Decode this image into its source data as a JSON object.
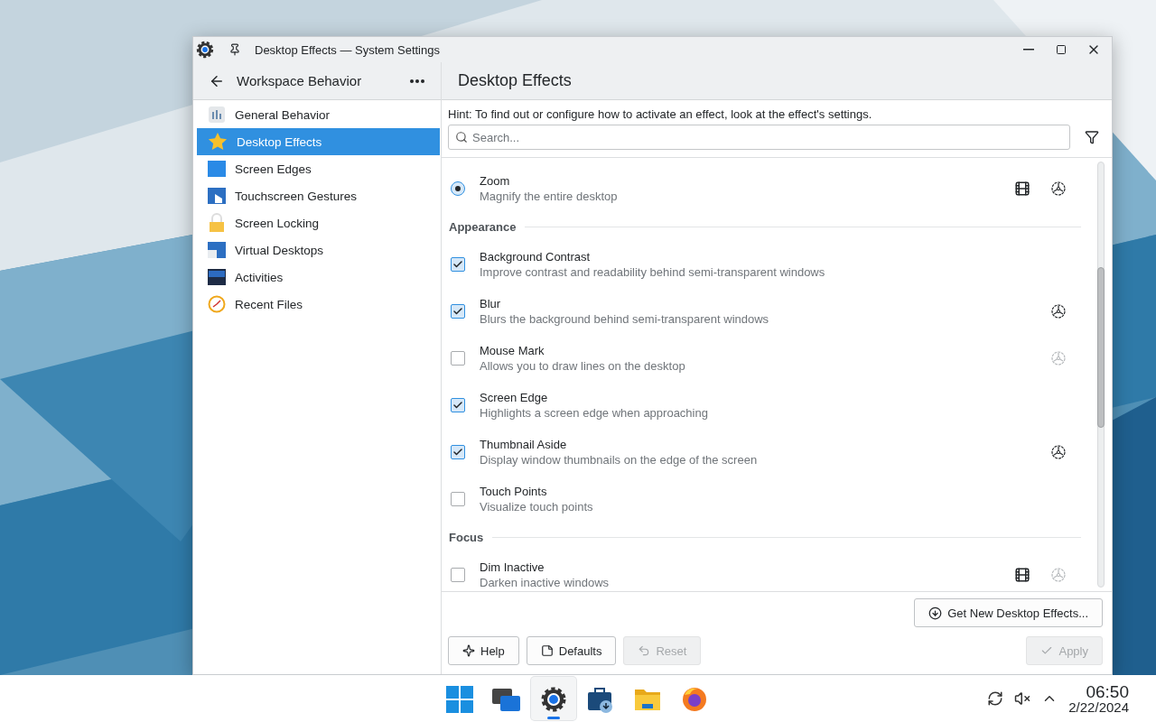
{
  "window": {
    "title": "Desktop Effects — System Settings"
  },
  "sidebar": {
    "title": "Workspace Behavior",
    "items": [
      {
        "label": "General Behavior",
        "selected": false
      },
      {
        "label": "Desktop Effects",
        "selected": true
      },
      {
        "label": "Screen Edges",
        "selected": false
      },
      {
        "label": "Touchscreen Gestures",
        "selected": false
      },
      {
        "label": "Screen Locking",
        "selected": false
      },
      {
        "label": "Virtual Desktops",
        "selected": false
      },
      {
        "label": "Activities",
        "selected": false
      },
      {
        "label": "Recent Files",
        "selected": false
      }
    ]
  },
  "page": {
    "title": "Desktop Effects",
    "hint": "Hint: To find out or configure how to activate an effect, look at the effect's settings.",
    "search": {
      "placeholder": "Search..."
    }
  },
  "effects": [
    {
      "kind": "radio",
      "name": "Zoom",
      "description": "Magnify the entire desktop",
      "selected": true,
      "video": true,
      "settings_enabled": true
    },
    {
      "kind": "section",
      "title": "Appearance"
    },
    {
      "kind": "checkbox",
      "name": "Background Contrast",
      "description": "Improve contrast and readability behind semi-transparent windows",
      "checked": true
    },
    {
      "kind": "checkbox",
      "name": "Blur",
      "description": "Blurs the background behind semi-transparent windows",
      "checked": true,
      "settings_enabled": true
    },
    {
      "kind": "checkbox",
      "name": "Mouse Mark",
      "description": "Allows you to draw lines on the desktop",
      "checked": false,
      "settings_enabled": false
    },
    {
      "kind": "checkbox",
      "name": "Screen Edge",
      "description": "Highlights a screen edge when approaching",
      "checked": true
    },
    {
      "kind": "checkbox",
      "name": "Thumbnail Aside",
      "description": "Display window thumbnails on the edge of the screen",
      "checked": true,
      "settings_enabled": true
    },
    {
      "kind": "checkbox",
      "name": "Touch Points",
      "description": "Visualize touch points",
      "checked": false
    },
    {
      "kind": "section",
      "title": "Focus"
    },
    {
      "kind": "checkbox",
      "name": "Dim Inactive",
      "description": "Darken inactive windows",
      "checked": false,
      "video": true,
      "settings_enabled": false
    }
  ],
  "get_new_button": "Get New Desktop Effects...",
  "buttons": [
    {
      "kind": "help",
      "label": "Help",
      "disabled": false
    },
    {
      "kind": "defaults",
      "label": "Defaults",
      "disabled": false
    },
    {
      "kind": "reset",
      "label": "Reset",
      "disabled": true
    },
    {
      "kind": "apply",
      "label": "Apply",
      "disabled": true
    }
  ],
  "taskbar": {
    "apps": [
      {
        "kind": "start",
        "active": false
      },
      {
        "kind": "windows",
        "active": false
      },
      {
        "kind": "settings",
        "active": true
      },
      {
        "kind": "store",
        "active": false
      },
      {
        "kind": "files",
        "active": false
      },
      {
        "kind": "browser",
        "active": false
      }
    ],
    "time": "06:50",
    "date": "2/22/2024"
  }
}
